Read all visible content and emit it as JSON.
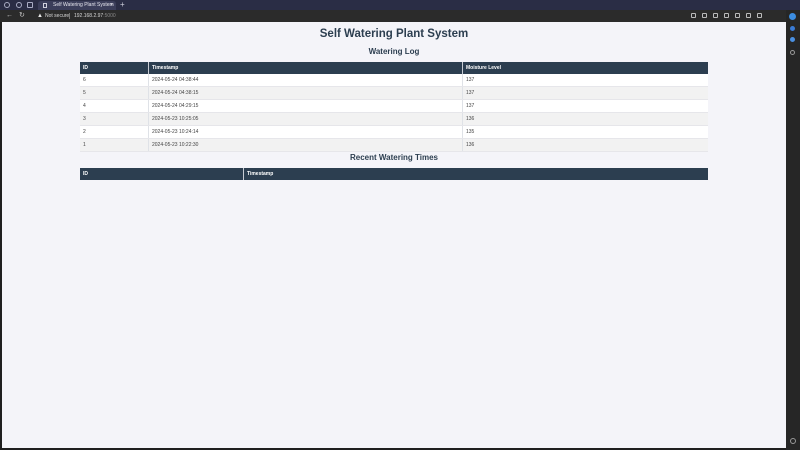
{
  "browser": {
    "tab_title": "Self Watering Plant System",
    "tab_close": "×",
    "new_tab": "+",
    "security_label": "Not secure",
    "url_host": "192.168.2.97",
    "url_port": ":5000"
  },
  "page": {
    "title": "Self Watering Plant System",
    "watering_log": {
      "heading": "Watering Log",
      "columns": [
        "ID",
        "Timestamp",
        "Moisture Level"
      ],
      "rows": [
        {
          "id": "6",
          "timestamp": "2024-05-24 04:38:44",
          "moisture": "137"
        },
        {
          "id": "5",
          "timestamp": "2024-05-24 04:38:15",
          "moisture": "137"
        },
        {
          "id": "4",
          "timestamp": "2024-05-24 04:29:15",
          "moisture": "137"
        },
        {
          "id": "3",
          "timestamp": "2024-05-23 10:25:05",
          "moisture": "136"
        },
        {
          "id": "2",
          "timestamp": "2024-05-23 10:24:14",
          "moisture": "135"
        },
        {
          "id": "1",
          "timestamp": "2024-05-23 10:22:30",
          "moisture": "136"
        }
      ]
    },
    "recent_watering": {
      "heading": "Recent Watering Times",
      "columns": [
        "ID",
        "Timestamp"
      ]
    }
  }
}
